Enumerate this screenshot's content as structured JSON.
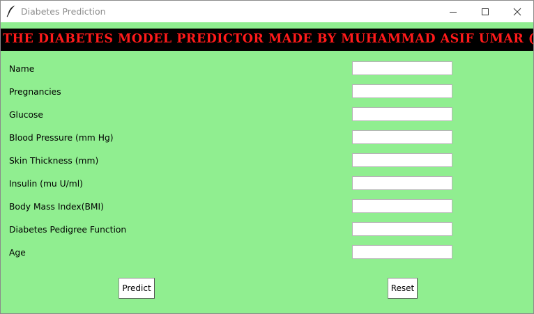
{
  "window": {
    "title": "Diabetes Prediction",
    "icon": "feather-icon",
    "controls": [
      "minimize-icon",
      "maximize-icon",
      "close-icon"
    ]
  },
  "banner": {
    "text": "The Diabetes Model Predictor Made by Muhammad Asif Umar (AI)",
    "text_color": "#ff1a1a",
    "background": "#000000"
  },
  "form": {
    "background": "#90ee90",
    "fields": [
      {
        "label": "Name",
        "value": ""
      },
      {
        "label": "Pregnancies",
        "value": ""
      },
      {
        "label": "Glucose",
        "value": ""
      },
      {
        "label": "Blood Pressure (mm Hg)",
        "value": ""
      },
      {
        "label": "Skin Thickness (mm)",
        "value": ""
      },
      {
        "label": "Insulin (mu U/ml)",
        "value": ""
      },
      {
        "label": "Body Mass Index(BMI)",
        "value": ""
      },
      {
        "label": "Diabetes Pedigree Function",
        "value": ""
      },
      {
        "label": "Age",
        "value": ""
      }
    ]
  },
  "buttons": {
    "predict_label": "Predict",
    "reset_label": "Reset"
  }
}
